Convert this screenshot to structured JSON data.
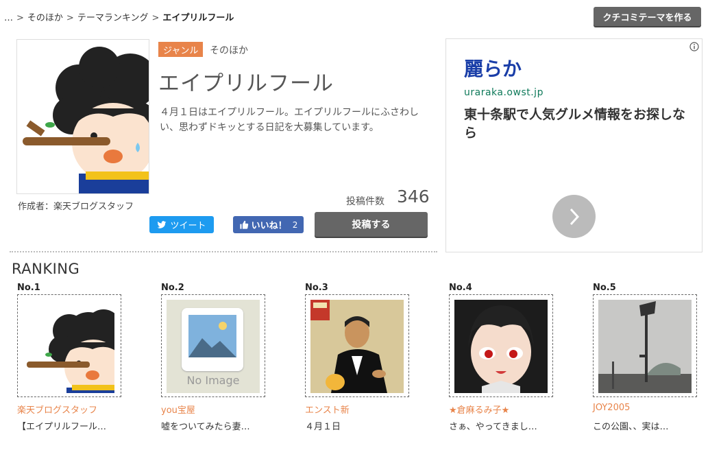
{
  "breadcrumb": {
    "items": [
      "…",
      "そのほか",
      "テーマランキング"
    ],
    "current": "エイプリルフール"
  },
  "create_button": "クチコミテーマを作る",
  "theme": {
    "genre_label": "ジャンル",
    "genre_value": "そのほか",
    "title": "エイプリルフール",
    "description": "４月１日はエイプリルフール。エイプリルフールにふさわしい、思わずドキッとする日記を大募集しています。",
    "author": "作成者：楽天ブログスタッフ",
    "post_count_label": "投稿件数",
    "post_count": "346",
    "tweet_label": "ツイート",
    "like_label": "いいね！",
    "like_count": "2",
    "post_button": "投稿する"
  },
  "ad": {
    "title": "麗らか",
    "url": "uraraka.owst.jp",
    "text": "東十条駅で人気グルメ情報をお探しなら",
    "colors": {
      "title": "#1a3ea8",
      "url": "#0f7a5a"
    }
  },
  "ranking": {
    "heading": "RANKING",
    "items": [
      {
        "no": "No.1",
        "user": "楽天ブログスタッフ",
        "snippet": "【エイプリルフール…"
      },
      {
        "no": "No.2",
        "user": "you宝屋",
        "snippet": "嘘をついてみたら妻…",
        "no_image": "No Image"
      },
      {
        "no": "No.3",
        "user": "エンスト新",
        "snippet": "４月１日"
      },
      {
        "no": "No.4",
        "user": "★倉麻るみ子★",
        "snippet": "さぁ、やってきまし…"
      },
      {
        "no": "No.5",
        "user": "JOY2005",
        "snippet": "この公園、、実は…"
      }
    ]
  },
  "colors": {
    "accent": "#e8844a",
    "button_dark": "#666666",
    "twitter": "#1d9bf0",
    "facebook": "#4267b2"
  }
}
